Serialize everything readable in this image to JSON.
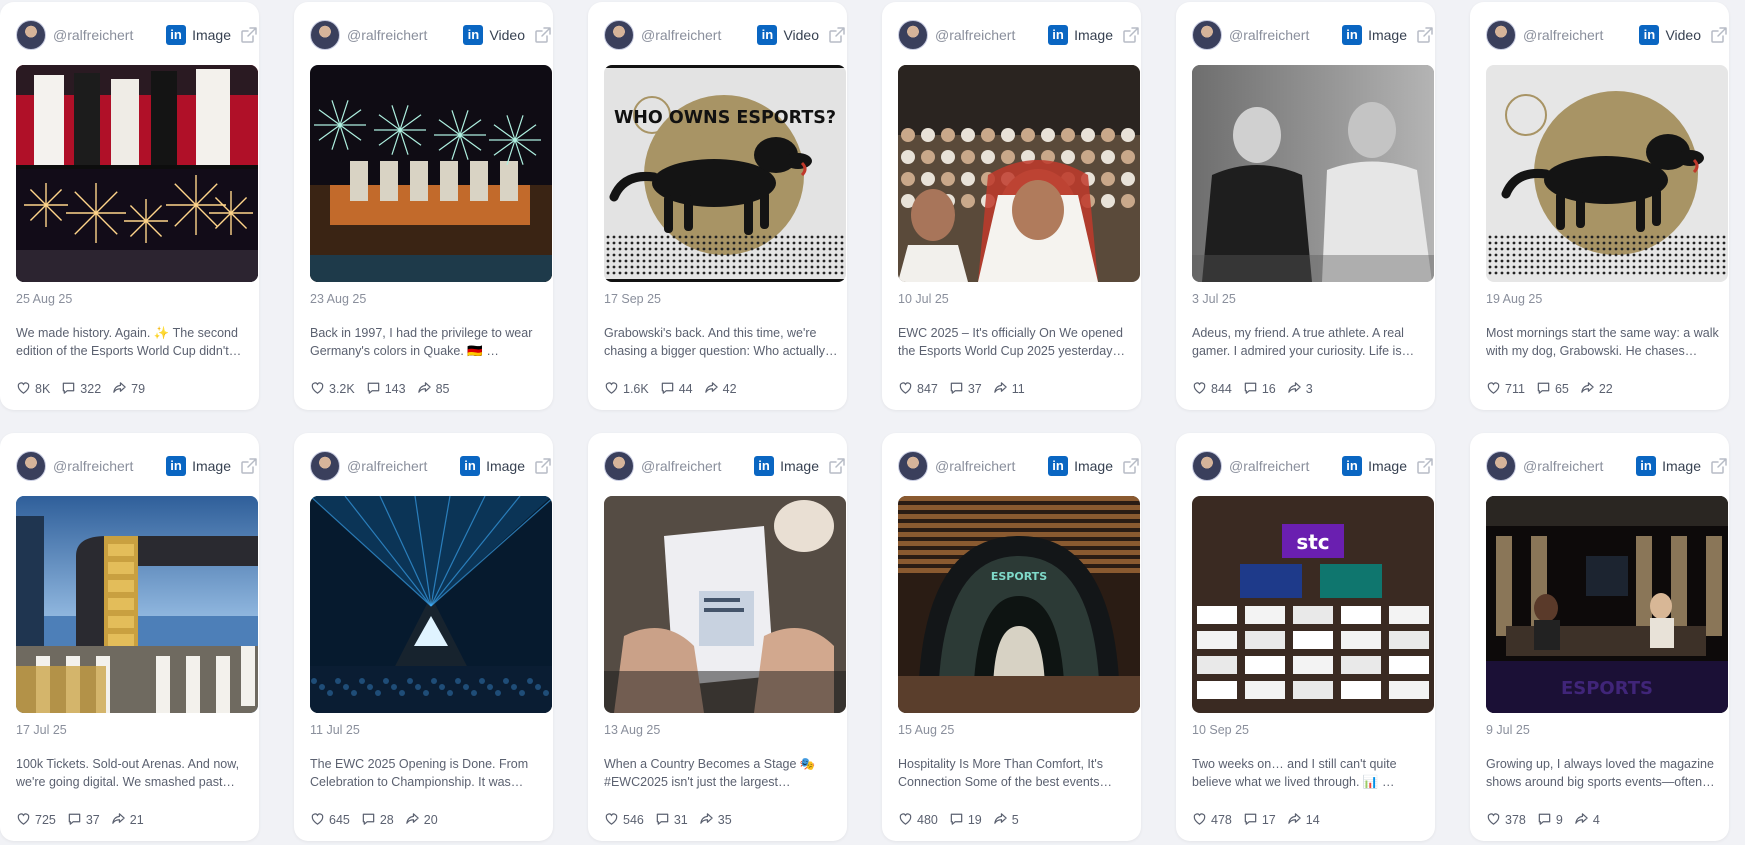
{
  "posts": [
    {
      "handle": "@ralfreichert",
      "type": "Image",
      "date": "25 Aug 25",
      "text": "We made history. Again. ✨ The second edition of the Esports World Cup didn't…",
      "likes": "8K",
      "comments": "322",
      "shares": "79"
    },
    {
      "handle": "@ralfreichert",
      "type": "Video",
      "date": "23 Aug 25",
      "text": "Back in 1997, I had the privilege to wear Germany's colors in Quake. 🇩🇪 …",
      "likes": "3.2K",
      "comments": "143",
      "shares": "85"
    },
    {
      "handle": "@ralfreichert",
      "type": "Video",
      "date": "17 Sep 25",
      "text": "Grabowski's back. And this time, we're chasing a bigger question: Who actually…",
      "likes": "1.6K",
      "comments": "44",
      "shares": "42",
      "image_text": "WHO OWNS ESPORTS?"
    },
    {
      "handle": "@ralfreichert",
      "type": "Image",
      "date": "10 Jul 25",
      "text": "EWC 2025 – It's officially On We opened the Esports World Cup 2025 yesterday…",
      "likes": "847",
      "comments": "37",
      "shares": "11"
    },
    {
      "handle": "@ralfreichert",
      "type": "Image",
      "date": "3 Jul 25",
      "text": "Adeus, my friend. A true athlete. A real gamer. I admired your curiosity. Life is…",
      "likes": "844",
      "comments": "16",
      "shares": "3"
    },
    {
      "handle": "@ralfreichert",
      "type": "Video",
      "date": "19 Aug 25",
      "text": "Most mornings start the same way: a walk with my dog, Grabowski. He chases…",
      "likes": "711",
      "comments": "65",
      "shares": "22"
    },
    {
      "handle": "@ralfreichert",
      "type": "Image",
      "date": "17 Jul 25",
      "text": "100k Tickets. Sold-out Arenas. And now, we're going digital. We smashed past…",
      "likes": "725",
      "comments": "37",
      "shares": "21"
    },
    {
      "handle": "@ralfreichert",
      "type": "Image",
      "date": "11 Jul 25",
      "text": "The EWC 2025 Opening is Done. From Celebration to Championship. It was…",
      "likes": "645",
      "comments": "28",
      "shares": "20"
    },
    {
      "handle": "@ralfreichert",
      "type": "Image",
      "date": "13 Aug 25",
      "text": "When a Country Becomes a Stage 🎭 #EWC2025 isn't just the largest…",
      "likes": "546",
      "comments": "31",
      "shares": "35"
    },
    {
      "handle": "@ralfreichert",
      "type": "Image",
      "date": "15 Aug 25",
      "text": "Hospitality Is More Than Comfort, It's Connection Some of the best events I've…",
      "likes": "480",
      "comments": "19",
      "shares": "5"
    },
    {
      "handle": "@ralfreichert",
      "type": "Image",
      "date": "10 Sep 25",
      "text": "Two weeks on… and I still can't quite believe what we lived through. 📊 …",
      "likes": "478",
      "comments": "17",
      "shares": "14",
      "image_text": "stc"
    },
    {
      "handle": "@ralfreichert",
      "type": "Image",
      "date": "9 Jul 25",
      "text": "Growing up, I always loved the magazine shows around big sports events—often…",
      "likes": "378",
      "comments": "9",
      "shares": "4"
    }
  ],
  "icons": {
    "network": "linkedin-icon",
    "open": "external-link-icon",
    "likes": "heart-icon",
    "comments": "comment-icon",
    "shares": "share-icon"
  },
  "colors": {
    "linkedin": "#0a66c2",
    "card": "#ffffff",
    "page": "#f1f2f6"
  }
}
